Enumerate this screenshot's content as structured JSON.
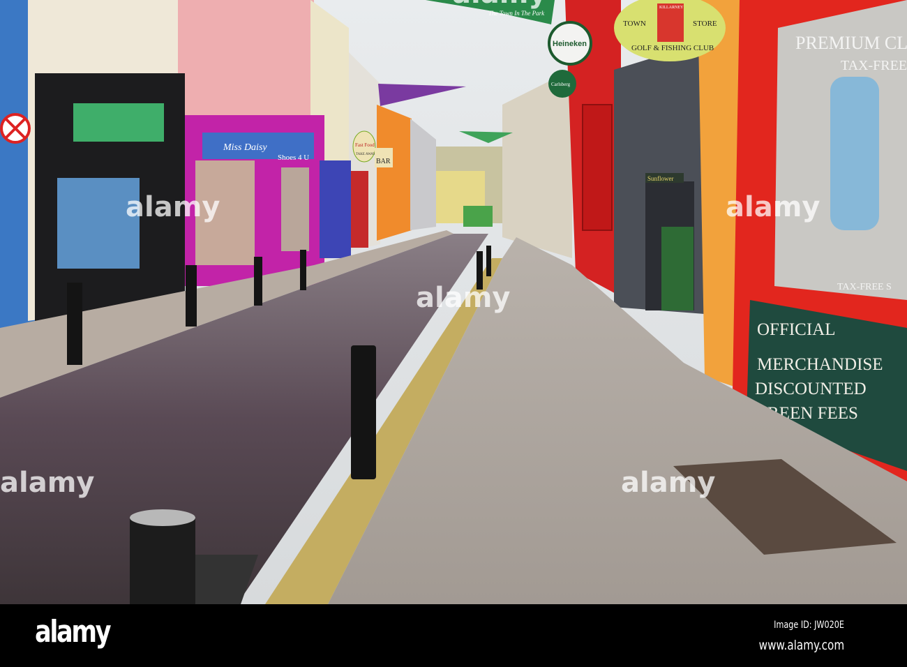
{
  "photo": {
    "signs": {
      "town": "TOWN",
      "store": "STORE",
      "golf_club": "GOLF & FISHING CLUB",
      "killarney": "KILLARNEY",
      "heineken": "Heineken",
      "carlsberg": "Carlsberg",
      "premium_club": "PREMIUM CLUB",
      "tax_free": "TAX-FREE",
      "tax_free_lower": "TAX-FREE S",
      "fast_food": "Fast Food",
      "take_away": "TAKE AWAY",
      "bar": "BAR",
      "banner": "The Town In The Park",
      "official_1": "OFFICIAL",
      "official_2": "MERCHANDISE",
      "discount_1": "DISCOUNTED",
      "discount_2": "GREEN FEES",
      "shop_pink": "Miss Daisy",
      "shop_pink2": "Shoes 4 U",
      "sunflower": "Sunflower"
    },
    "watermark": "alamy"
  },
  "footer": {
    "logo": "alamy",
    "image_id": "Image ID: JW020E",
    "website": "www.alamy.com"
  }
}
